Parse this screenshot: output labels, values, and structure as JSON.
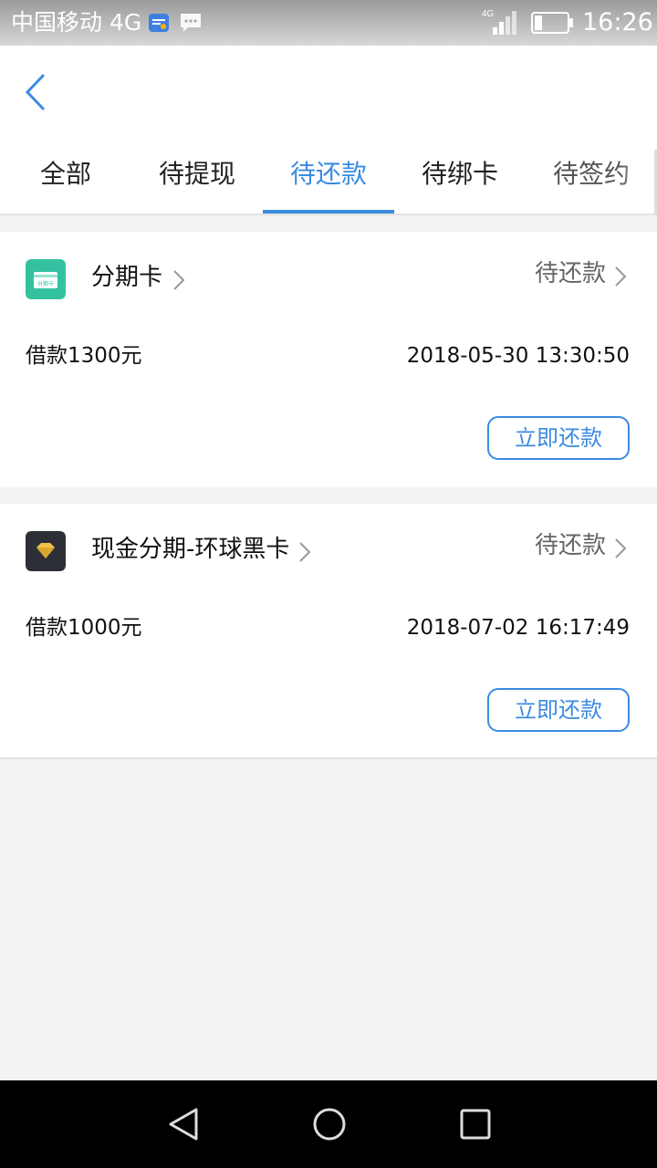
{
  "status_bar": {
    "carrier": "中国移动 4G",
    "network": "4G",
    "time": "16:26"
  },
  "header": {
    "back_icon": "chevron-left-icon",
    "tabs": [
      {
        "label": "全部",
        "active": false
      },
      {
        "label": "待提现",
        "active": false
      },
      {
        "label": "待还款",
        "active": true
      },
      {
        "label": "待绑卡",
        "active": false
      },
      {
        "label": "待签约",
        "active": false
      }
    ]
  },
  "loans": [
    {
      "product": "分期卡",
      "icon_label": "分期卡",
      "icon_color": "#34c1a1",
      "status": "待还款",
      "amount": "借款1300元",
      "time": "2018-05-30 13:30:50",
      "action": "立即还款"
    },
    {
      "product": "现金分期-环球黑卡",
      "icon": "diamond-icon",
      "icon_color": "#2c2f36",
      "status": "待还款",
      "amount": "借款1000元",
      "time": "2018-07-02 16:17:49",
      "action": "立即还款"
    }
  ],
  "colors": {
    "accent": "#3b8be0",
    "background": "#f2f3f3"
  }
}
